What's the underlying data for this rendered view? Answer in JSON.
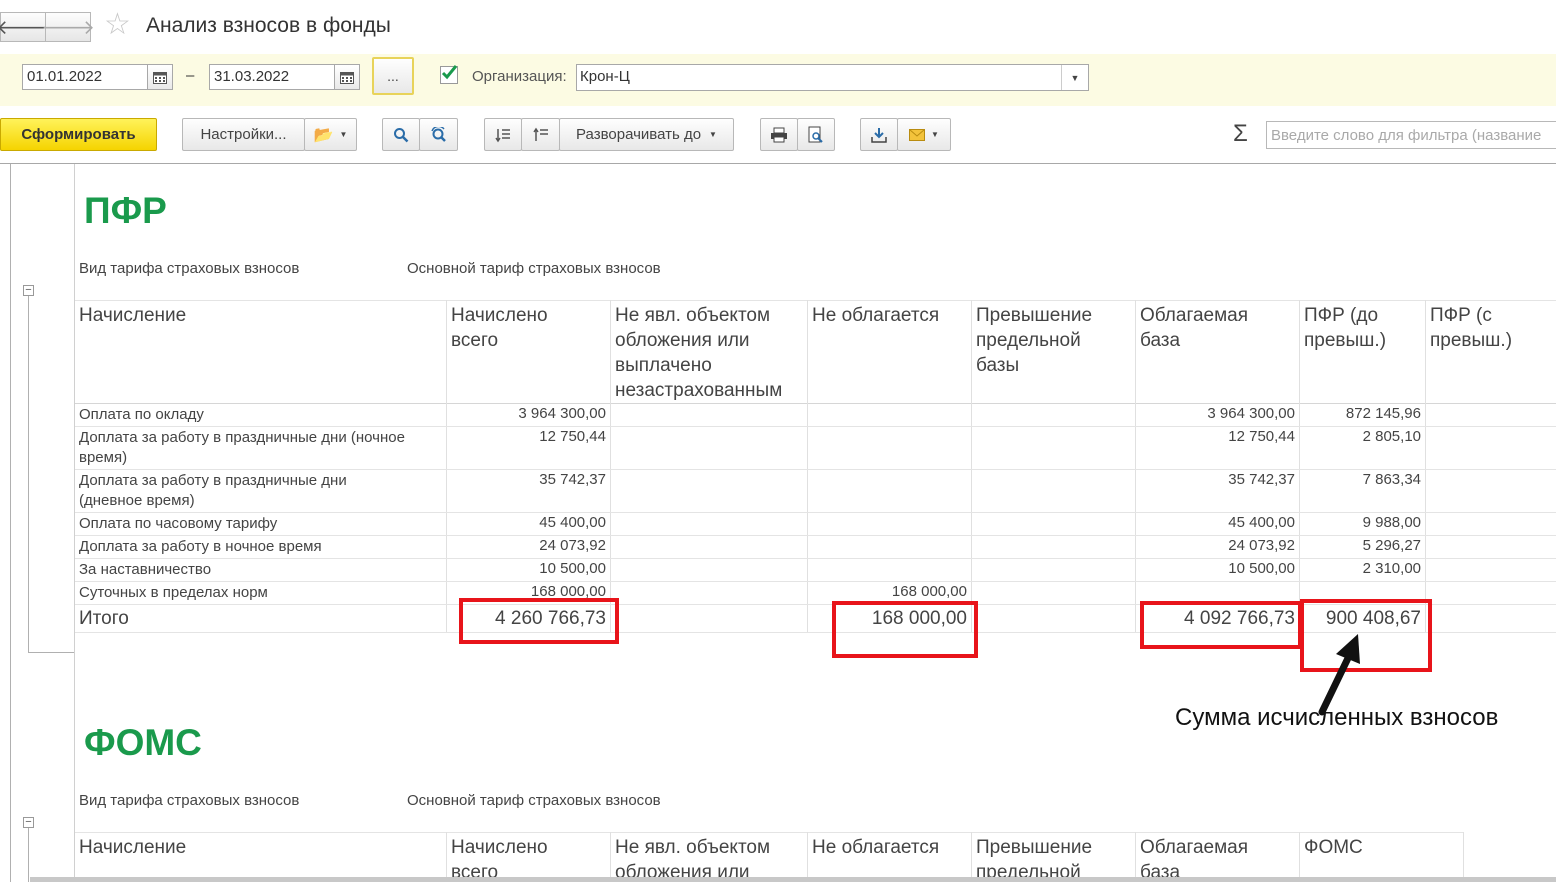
{
  "window": {
    "title": "Анализ взносов в фонды"
  },
  "params": {
    "date_from": "01.01.2022",
    "dash": "–",
    "date_to": "31.03.2022",
    "more_label": "...",
    "org_label": "Организация:",
    "org_value": "Крон-Ц"
  },
  "toolbar": {
    "generate_label": "Сформировать",
    "settings_label": "Настройки...",
    "expand_label": "Разворачивать до",
    "sigma": "Σ",
    "filter_placeholder": "Введите слово для фильтра (название"
  },
  "columns": [
    "Начисление",
    "Начислено всего",
    "Не явл. объектом обложения или выплачено незастрахованным",
    "Не облагается",
    "Превышение предельной базы",
    "Облагаемая база",
    "ПФР (до превыш.)",
    "ПФР (с превыш.)"
  ],
  "pfr": {
    "title": "ПФР",
    "tariff_label": "Вид тарифа страховых взносов",
    "tariff_value": "Основной тариф страховых взносов",
    "rows": [
      {
        "name": "Оплата по окладу",
        "total": "3 964 300,00",
        "exempt": "",
        "base": "3 964 300,00",
        "pfr": "872 145,96"
      },
      {
        "name": "Доплата за работу в праздничные дни (ночное время)",
        "total": "12 750,44",
        "exempt": "",
        "base": "12 750,44",
        "pfr": "2 805,10"
      },
      {
        "name": "Доплата за работу в праздничные дни (дневное время)",
        "total": "35 742,37",
        "exempt": "",
        "base": "35 742,37",
        "pfr": "7 863,34"
      },
      {
        "name": "Оплата по часовому тарифу",
        "total": "45 400,00",
        "exempt": "",
        "base": "45 400,00",
        "pfr": "9 988,00"
      },
      {
        "name": "Доплата за работу в ночное время",
        "total": "24 073,92",
        "exempt": "",
        "base": "24 073,92",
        "pfr": "5 296,27"
      },
      {
        "name": "За наставничество",
        "total": "10 500,00",
        "exempt": "",
        "base": "10 500,00",
        "pfr": "2 310,00"
      },
      {
        "name": "Суточных в пределах норм",
        "total": "168 000,00",
        "exempt": "168 000,00",
        "base": "",
        "pfr": ""
      }
    ],
    "total": {
      "name": "Итого",
      "total": "4 260 766,73",
      "exempt": "168 000,00",
      "base": "4 092 766,73",
      "pfr": "900 408,67"
    },
    "annotation": "Сумма исчисленных взносов"
  },
  "foms": {
    "title": "ФОМС",
    "tariff_label": "Вид тарифа страховых взносов",
    "tariff_value": "Основной тариф страховых взносов",
    "columns": [
      "Начисление",
      "Начислено всего",
      "Не явл. объектом обложения или",
      "Не облагается",
      "Превышение предельной",
      "Облагаемая база",
      "ФОМС"
    ]
  }
}
